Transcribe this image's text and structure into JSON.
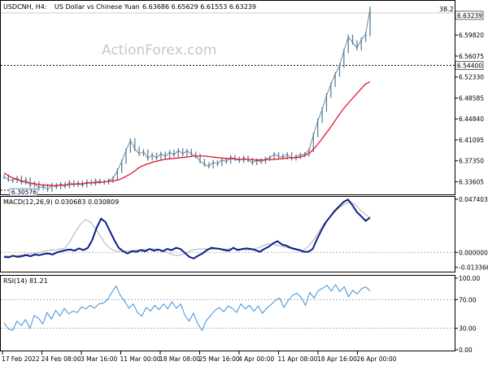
{
  "header": {
    "symbol": "USDCNH, H4:",
    "description": "US Dollar vs Chinese Yuan",
    "ohlc": "6.63686 6.65629 6.61553 6.63239"
  },
  "watermark": "ActionForex.com",
  "colors": {
    "price": "#5b7f97",
    "sma": "#e8132c",
    "macd": "#0c1e86",
    "signal": "#b0b0b0",
    "rsi": "#3a90d8",
    "grid_line": "#000000"
  },
  "chart_data": [
    {
      "type": "line",
      "panel": "price",
      "y_ticks": [
        "6.59820",
        "6.56075",
        "6.52330",
        "6.48585",
        "6.44840",
        "6.41095",
        "6.37350",
        "6.33605"
      ],
      "ylim": [
        6.315,
        6.658
      ],
      "labels": {
        "current": "6.63239",
        "line_level": "6.54400",
        "low": "6.30576",
        "top_corner": "38.2"
      },
      "line_level_value": 6.544,
      "series": [
        {
          "values": [
            6.345,
            6.34,
            6.338,
            6.343,
            6.335,
            6.34,
            6.33,
            6.333,
            6.325,
            6.328,
            6.322,
            6.33,
            6.327,
            6.332,
            6.328,
            6.335,
            6.331,
            6.334,
            6.33,
            6.336,
            6.333,
            6.338,
            6.336,
            6.335,
            6.338,
            6.342,
            6.356,
            6.372,
            6.392,
            6.41,
            6.395,
            6.386,
            6.39,
            6.378,
            6.384,
            6.379,
            6.386,
            6.381,
            6.389,
            6.384,
            6.392,
            6.386,
            6.391,
            6.386,
            6.382,
            6.373,
            6.367,
            6.364,
            6.371,
            6.368,
            6.375,
            6.372,
            6.38,
            6.377,
            6.374,
            6.379,
            6.375,
            6.37,
            6.374,
            6.372,
            6.377,
            6.379,
            6.385,
            6.382,
            6.38,
            6.385,
            6.378,
            6.381,
            6.384,
            6.385,
            6.393,
            6.42,
            6.445,
            6.465,
            6.49,
            6.51,
            6.528,
            6.544,
            6.57,
            6.595,
            6.585,
            6.575,
            6.59,
            6.6,
            6.645
          ]
        },
        {
          "values": [
            6.352,
            6.346,
            6.342,
            6.339,
            6.336,
            6.334,
            6.333,
            6.331,
            6.33,
            6.33,
            6.329,
            6.33,
            6.33,
            6.331,
            6.332,
            6.332,
            6.333,
            6.334,
            6.334,
            6.335,
            6.336,
            6.337,
            6.338,
            6.34,
            6.344,
            6.349,
            6.355,
            6.362,
            6.366,
            6.369,
            6.372,
            6.374,
            6.376,
            6.377,
            6.378,
            6.379,
            6.38,
            6.381,
            6.382,
            6.382,
            6.382,
            6.381,
            6.38,
            6.379,
            6.378,
            6.377,
            6.377,
            6.376,
            6.376,
            6.376,
            6.375,
            6.375,
            6.375,
            6.376,
            6.376,
            6.377,
            6.378,
            6.379,
            6.379,
            6.38,
            6.383,
            6.388,
            6.397,
            6.408,
            6.42,
            6.432,
            6.445,
            6.458,
            6.47,
            6.48,
            6.49,
            6.5,
            6.51,
            6.515
          ]
        }
      ]
    },
    {
      "type": "line",
      "panel": "macd",
      "label": "MACD(12,26,9) 0.030683 0.030809",
      "y_ticks": [
        "0.047403",
        "0.000000",
        "-0.013366"
      ],
      "ylim": [
        -0.0165,
        0.0495
      ],
      "series": [
        {
          "values": [
            -0.004,
            -0.0045,
            -0.003,
            -0.004,
            -0.0035,
            -0.0025,
            -0.0035,
            -0.002,
            -0.0025,
            -0.0015,
            -0.001,
            -0.002,
            0.0,
            0.001,
            0.002,
            0.0025,
            0.0015,
            0.0035,
            0.002,
            0.004,
            0.011,
            0.022,
            0.03,
            0.027,
            0.019,
            0.011,
            0.004,
            0.001,
            -0.001,
            0.001,
            0.0005,
            0.002,
            0.001,
            0.003,
            0.0015,
            0.0025,
            0.001,
            0.003,
            0.002,
            0.004,
            0.003,
            -0.0005,
            -0.004,
            -0.0055,
            -0.003,
            -0.001,
            0.002,
            0.004,
            0.0035,
            0.003,
            0.002,
            0.0015,
            0.004,
            0.002,
            0.003,
            0.0035,
            0.003,
            0.002,
            0.0005,
            0.003,
            0.005,
            0.008,
            0.01,
            0.007,
            0.006,
            0.004,
            0.003,
            0.002,
            0.0005,
            0.0005,
            0.003,
            0.012,
            0.02,
            0.027,
            0.032,
            0.037,
            0.041,
            0.045,
            0.047,
            0.042,
            0.036,
            0.032,
            0.028,
            0.031
          ]
        },
        {
          "values": [
            -0.003,
            -0.0035,
            -0.003,
            -0.0025,
            -0.002,
            -0.0015,
            -0.001,
            0.0,
            0.001,
            0.002,
            0.002,
            0.003,
            0.004,
            0.01,
            0.018,
            0.025,
            0.029,
            0.027,
            0.021,
            0.014,
            0.007,
            0.003,
            0.001,
            0.001,
            0.001,
            0.0015,
            0.002,
            0.0025,
            0.0025,
            0.003,
            0.003,
            0.002,
            0.0,
            -0.002,
            -0.003,
            -0.002,
            0.0,
            0.002,
            0.003,
            0.003,
            0.003,
            0.0025,
            0.0035,
            0.003,
            0.003,
            0.0035,
            0.003,
            0.0025,
            0.002,
            0.003,
            0.004,
            0.006,
            0.0075,
            0.007,
            0.006,
            0.005,
            0.004,
            0.0025,
            0.0015,
            0.002,
            0.006,
            0.012,
            0.019,
            0.026,
            0.031,
            0.036,
            0.04,
            0.043,
            0.045,
            0.043,
            0.038,
            0.034,
            0.031
          ]
        }
      ]
    },
    {
      "type": "line",
      "panel": "rsi",
      "label": "RSI(14) 81.21",
      "y_ticks": [
        "100.00",
        "70.00",
        "30.00",
        "0.00"
      ],
      "levels": [
        70,
        30
      ],
      "ylim": [
        0,
        100
      ],
      "series": [
        {
          "values": [
            38,
            29,
            27,
            40,
            34,
            42,
            30,
            48,
            44,
            36,
            52,
            43,
            55,
            47,
            58,
            50,
            54,
            52,
            60,
            57,
            62,
            58,
            64,
            65,
            70,
            80,
            89,
            76,
            68,
            58,
            64,
            52,
            47,
            59,
            54,
            62,
            56,
            64,
            57,
            67,
            58,
            64,
            48,
            40,
            51,
            36,
            27,
            41,
            48,
            55,
            59,
            53,
            61,
            58,
            52,
            64,
            57,
            62,
            54,
            61,
            51,
            58,
            63,
            69,
            72,
            59,
            69,
            76,
            79,
            73,
            62,
            80,
            72,
            83,
            86,
            90,
            82,
            91,
            81,
            88,
            74,
            83,
            78,
            85,
            88,
            82
          ]
        }
      ]
    }
  ],
  "x_ticks": [
    "17 Feb 2022",
    "24 Feb 08:00",
    "3 Mar 16:00",
    "11 Mar 00:00",
    "18 Mar 08:00",
    "25 Mar 16:00",
    "4 Apr 00:00",
    "11 Apr 08:00",
    "18 Apr 16:00",
    "26 Apr 00:00"
  ]
}
